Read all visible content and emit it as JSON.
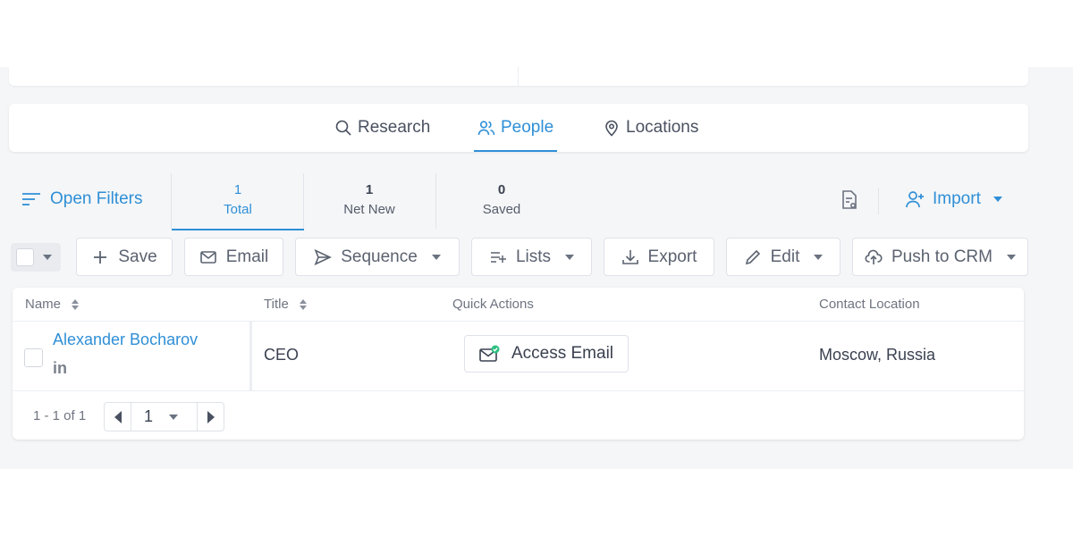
{
  "colors": {
    "accent": "#2f8fd6",
    "text": "#3a4150",
    "muted": "#6e7480",
    "canvas": "#f5f6f8",
    "success": "#2bbf7f"
  },
  "tabs": [
    {
      "label": "Research",
      "icon": "search-icon",
      "active": false
    },
    {
      "label": "People",
      "icon": "people-icon",
      "active": true
    },
    {
      "label": "Locations",
      "icon": "location-pin-icon",
      "active": false
    }
  ],
  "filters": {
    "label": "Open Filters",
    "icon": "filter-lines-icon"
  },
  "stats": [
    {
      "value": "1",
      "label": "Total",
      "active": true
    },
    {
      "value": "1",
      "label": "Net New",
      "active": false
    },
    {
      "value": "0",
      "label": "Saved",
      "active": false
    }
  ],
  "header_actions": {
    "doc_icon": "document-settings-icon",
    "import_label": "Import",
    "import_icon": "add-user-icon"
  },
  "toolbar": {
    "save": "Save",
    "email": "Email",
    "sequence": "Sequence",
    "lists": "Lists",
    "export": "Export",
    "edit": "Edit",
    "push_to_crm": "Push to CRM"
  },
  "table": {
    "columns": [
      "Name",
      "Title",
      "Quick Actions",
      "Contact Location"
    ],
    "rows": [
      {
        "name": "Alexander Bocharov",
        "social": "in",
        "title": "CEO",
        "quick_action": "Access Email",
        "location": "Moscow, Russia"
      }
    ]
  },
  "pagination": {
    "range": "1 - 1 of 1",
    "page": "1"
  }
}
